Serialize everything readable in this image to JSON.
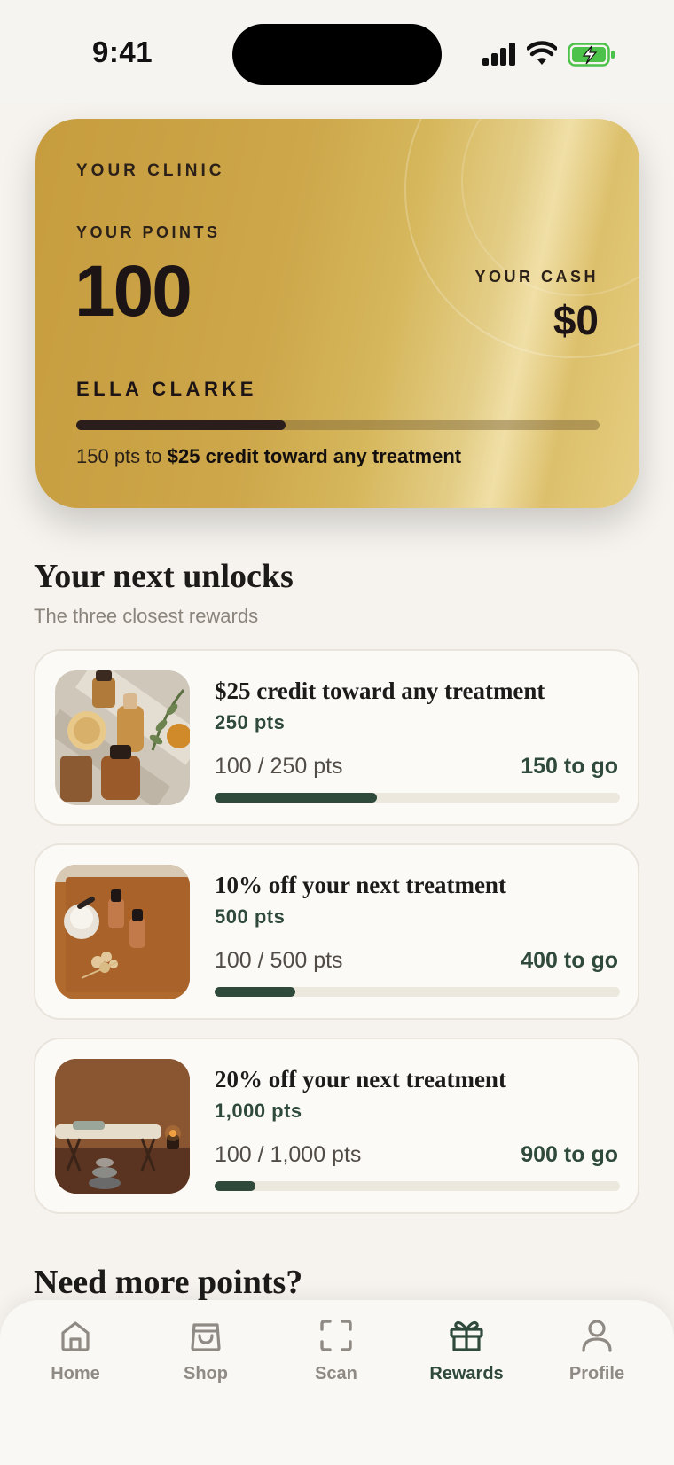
{
  "status_bar": {
    "time": "9:41"
  },
  "card": {
    "clinic_label": "YOUR CLINIC",
    "points_label": "YOUR POINTS",
    "points": "100",
    "cash_label": "YOUR CASH",
    "cash": "$0",
    "member_name": "ELLA CLARKE",
    "progress_fraction": 0.4,
    "caption_prefix": "150 pts to",
    "caption_reward": "$25 credit toward any treatment"
  },
  "unlocks": {
    "title": "Your next unlocks",
    "subtitle": "The three closest rewards",
    "items": [
      {
        "title": "$25 credit toward any treatment",
        "cost": "250 pts",
        "progress_text": "100 / 250 pts",
        "to_go": "150 to go",
        "progress_fraction": 0.4
      },
      {
        "title": "10% off your next treatment",
        "cost": "500 pts",
        "progress_text": "100 / 500 pts",
        "to_go": "400 to go",
        "progress_fraction": 0.2
      },
      {
        "title": "20% off your next treatment",
        "cost": "1,000 pts",
        "progress_text": "100 / 1,000 pts",
        "to_go": "900 to go",
        "progress_fraction": 0.1
      }
    ]
  },
  "more": {
    "title": "Need more points?"
  },
  "tabbar": {
    "items": [
      {
        "label": "Home",
        "icon": "home-icon"
      },
      {
        "label": "Shop",
        "icon": "shopping-bag-icon"
      },
      {
        "label": "Scan",
        "icon": "scan-icon"
      },
      {
        "label": "Rewards",
        "icon": "gift-icon",
        "active": true
      },
      {
        "label": "Profile",
        "icon": "user-icon"
      }
    ]
  },
  "colors": {
    "accent": "#2f4a3a",
    "background": "#f6f3ee",
    "gold": "#d6b75c"
  }
}
